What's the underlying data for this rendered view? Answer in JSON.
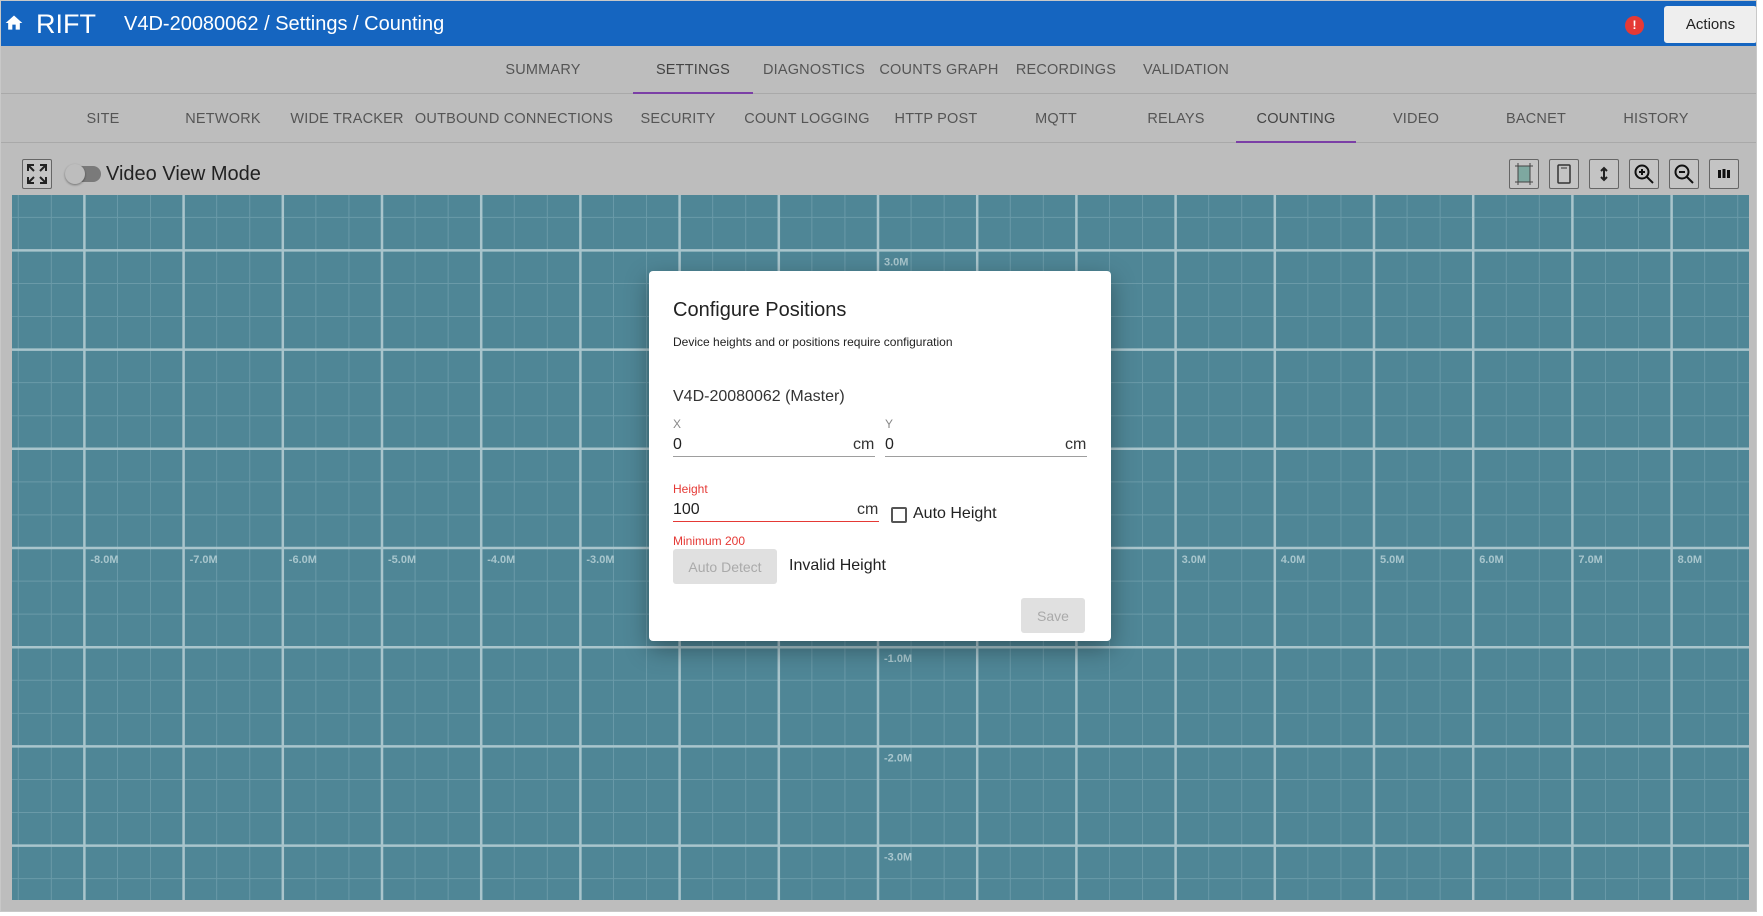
{
  "header": {
    "brand": "RIFT",
    "breadcrumb": "V4D-20080062 / Settings / Counting",
    "alert_symbol": "!",
    "actions_label": "Actions"
  },
  "main_tabs": [
    {
      "label": "SUMMARY",
      "active": false
    },
    {
      "label": "SETTINGS",
      "active": true
    },
    {
      "label": "DIAGNOSTICS",
      "active": false
    },
    {
      "label": "COUNTS GRAPH",
      "active": false
    },
    {
      "label": "RECORDINGS",
      "active": false
    },
    {
      "label": "VALIDATION",
      "active": false
    }
  ],
  "sub_tabs": [
    {
      "label": "SITE",
      "active": false
    },
    {
      "label": "NETWORK",
      "active": false
    },
    {
      "label": "WIDE TRACKER",
      "active": false
    },
    {
      "label": "OUTBOUND CONNECTIONS",
      "active": false
    },
    {
      "label": "SECURITY",
      "active": false
    },
    {
      "label": "COUNT LOGGING",
      "active": false
    },
    {
      "label": "HTTP POST",
      "active": false
    },
    {
      "label": "MQTT",
      "active": false
    },
    {
      "label": "RELAYS",
      "active": false
    },
    {
      "label": "COUNTING",
      "active": true
    },
    {
      "label": "VIDEO",
      "active": false
    },
    {
      "label": "BACNET",
      "active": false
    },
    {
      "label": "HISTORY",
      "active": false
    }
  ],
  "toolbar": {
    "video_view_label": "Video View Mode",
    "video_view_on": false,
    "tools": [
      "fit-area-icon",
      "device-outline-icon",
      "height-arrows-icon",
      "zoom-in-icon",
      "zoom-out-icon",
      "color-bars-icon"
    ]
  },
  "grid": {
    "x_labels": [
      "-8.0M",
      "-7.0M",
      "-6.0M",
      "-5.0M",
      "-4.0M",
      "-3.0M",
      "3.0M",
      "4.0M",
      "5.0M",
      "6.0M",
      "7.0M",
      "8.0M"
    ],
    "y_labels": [
      "3.0M",
      "-1.0M",
      "-2.0M",
      "-3.0M"
    ]
  },
  "dialog": {
    "title": "Configure Positions",
    "subtitle": "Device heights and or positions require configuration",
    "device": "V4D-20080062 (Master)",
    "x_label": "X",
    "x_value": "0",
    "y_label": "Y",
    "y_value": "0",
    "unit": "cm",
    "height_label": "Height",
    "height_value": "100",
    "auto_height_label": "Auto Height",
    "auto_height_checked": false,
    "height_error": "Minimum 200",
    "auto_detect_label": "Auto Detect",
    "status": "Invalid Height",
    "save_label": "Save"
  },
  "colors": {
    "appbar": "#1565c0",
    "tab_indicator": "#7b3fa6",
    "canvas": "#4f8696",
    "error": "#e53935"
  }
}
